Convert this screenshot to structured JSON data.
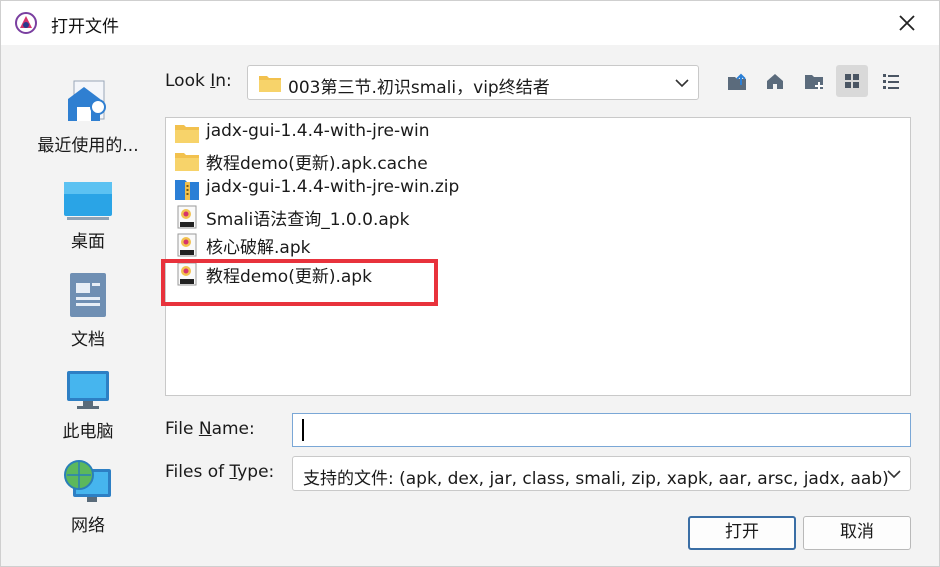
{
  "window": {
    "title": "打开文件",
    "icon": "jadx-app-icon",
    "close_icon": "close-icon"
  },
  "places": [
    {
      "label": "最近使用的...",
      "icon": "recent-places-icon"
    },
    {
      "label": "桌面",
      "icon": "desktop-icon"
    },
    {
      "label": "文档",
      "icon": "documents-icon"
    },
    {
      "label": "此电脑",
      "icon": "computer-icon"
    },
    {
      "label": "网络",
      "icon": "network-icon"
    }
  ],
  "lookin": {
    "label_pre": "Look ",
    "label_u": "I",
    "label_post": "n:",
    "value": "003第三节.初识smali，vip终结者"
  },
  "toolbar": [
    "up-folder-icon",
    "home-icon",
    "new-folder-icon",
    "list-view-icon",
    "details-view-icon"
  ],
  "files": [
    {
      "name": "jadx-gui-1.4.4-with-jre-win",
      "icon": "folder-icon"
    },
    {
      "name": "教程demo(更新).apk.cache",
      "icon": "folder-icon"
    },
    {
      "name": "jadx-gui-1.4.4-with-jre-win.zip",
      "icon": "zip-archive-icon"
    },
    {
      "name": "Smali语法查询_1.0.0.apk",
      "icon": "apk-file-icon"
    },
    {
      "name": "核心破解.apk",
      "icon": "apk-file-icon"
    },
    {
      "name": "教程demo(更新).apk",
      "icon": "apk-file-icon"
    }
  ],
  "file_name": {
    "label_pre": "File ",
    "label_u": "N",
    "label_post": "ame:",
    "value": ""
  },
  "file_type": {
    "label_pre": "Files of ",
    "label_u": "T",
    "label_post": "ype:",
    "value": "支持的文件: (apk, dex, jar, class, smali, zip, xapk, aar, arsc, jadx, aab)"
  },
  "buttons": {
    "open": "打开",
    "cancel": "取消"
  },
  "colors": {
    "highlight": "#e8323c",
    "folder": "#f2c14e",
    "accent": "#3a6ea5"
  }
}
